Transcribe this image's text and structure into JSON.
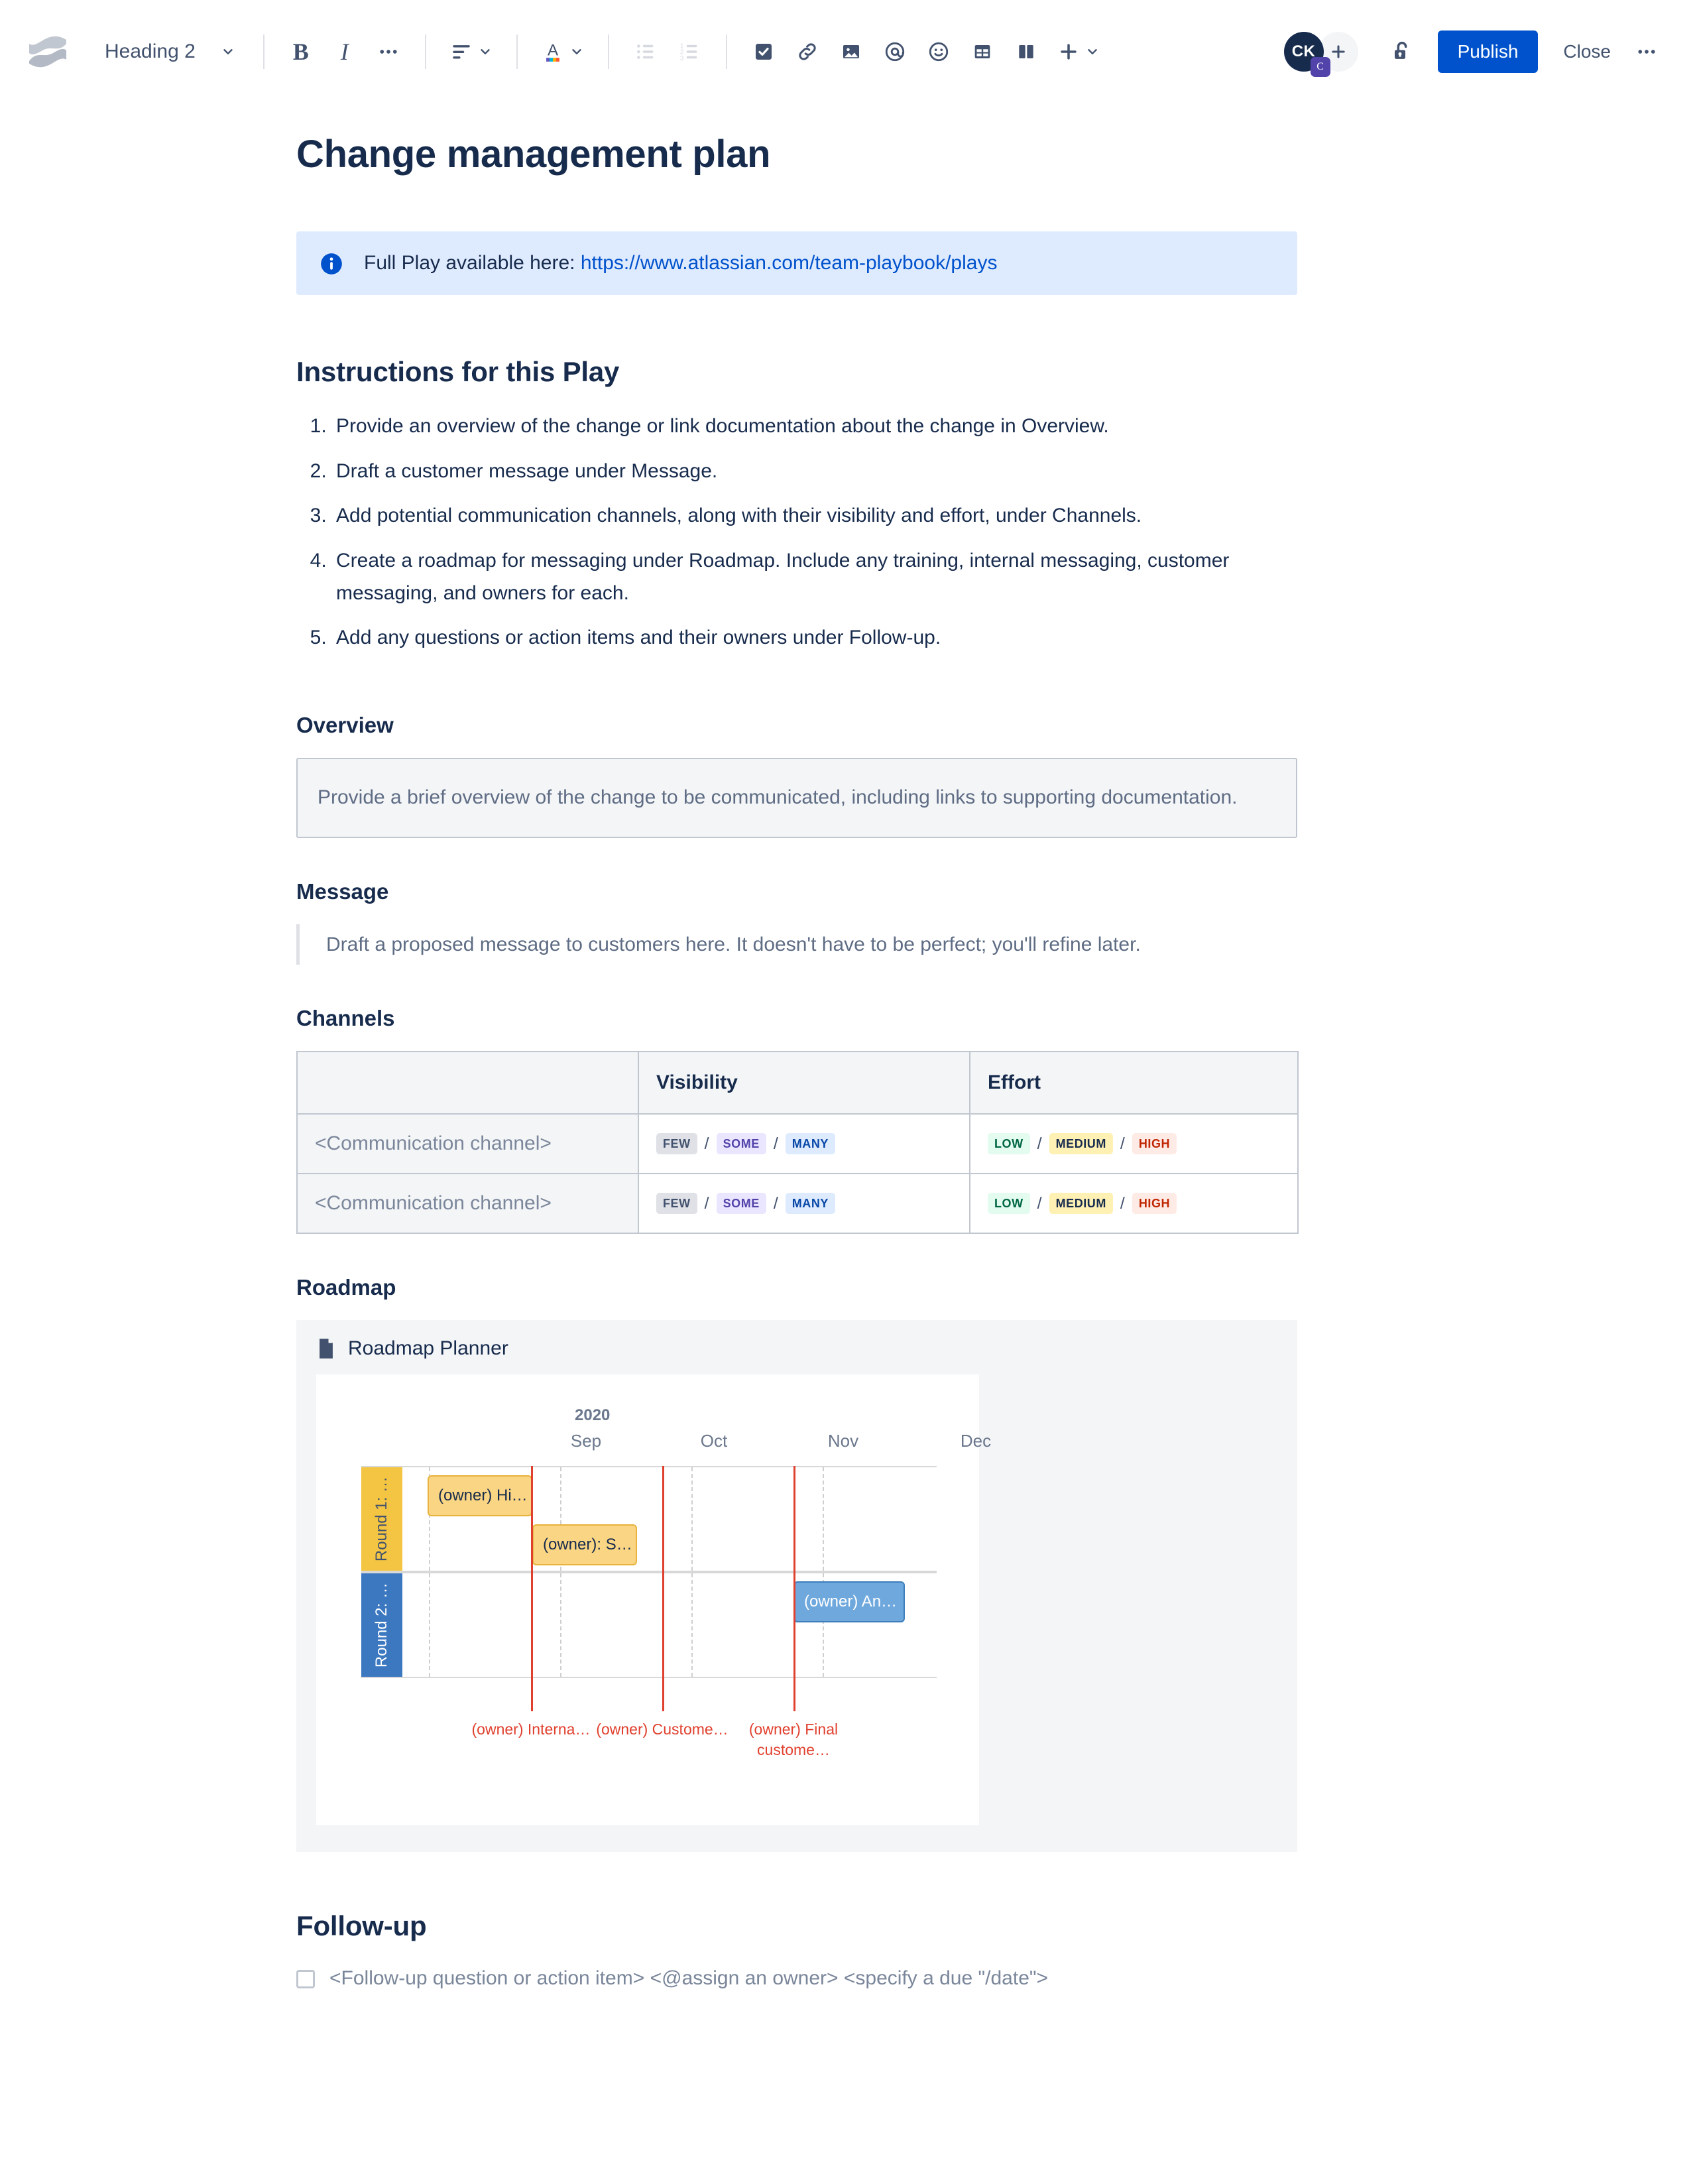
{
  "toolbar": {
    "logo_name": "confluence-logo",
    "heading_select": {
      "label": "Heading 2"
    },
    "buttons": [
      {
        "name": "bold",
        "label": "B"
      },
      {
        "name": "italic",
        "label": "I"
      },
      {
        "name": "more-formatting",
        "label": "..."
      },
      {
        "name": "text-align",
        "label": "Align"
      },
      {
        "name": "text-color",
        "label": "A"
      },
      {
        "name": "bullet-list",
        "label": "Bullet list"
      },
      {
        "name": "numbered-list",
        "label": "Numbered list"
      },
      {
        "name": "action-item",
        "label": "Action item"
      },
      {
        "name": "link",
        "label": "Link"
      },
      {
        "name": "image",
        "label": "Image"
      },
      {
        "name": "mention",
        "label": "Mention"
      },
      {
        "name": "emoji",
        "label": "Emoji"
      },
      {
        "name": "table",
        "label": "Table"
      },
      {
        "name": "layout",
        "label": "Layout"
      },
      {
        "name": "insert-more",
        "label": "Insert"
      }
    ],
    "avatar": {
      "initials": "CK",
      "badge": "C"
    },
    "add_people_label": "+",
    "publish_label": "Publish",
    "close_label": "Close",
    "more_label": "···",
    "accent_color": "#0052CC"
  },
  "document": {
    "title": "Change management plan",
    "info_panel": {
      "prefix": "Full Play available here: ",
      "link_text": "https://www.atlassian.com/team-playbook/plays"
    },
    "instructions_heading": "Instructions for this Play",
    "instructions": [
      "Provide an overview of the change or link documentation about the change in Overview.",
      "Draft a customer message under Message.",
      "Add potential communication channels, along with their visibility and effort, under Channels.",
      "Create a roadmap for messaging under Roadmap. Include any training, internal messaging, customer messaging, and owners for each.",
      "Add any questions or action items and their owners under Follow-up."
    ],
    "overview": {
      "heading": "Overview",
      "placeholder": "Provide a brief overview of the change to be communicated, including links to supporting documentation."
    },
    "message": {
      "heading": "Message",
      "placeholder": "Draft a proposed message to customers here. It doesn't have to be perfect; you'll refine later."
    },
    "channels": {
      "heading": "Channels",
      "columns": [
        "",
        "Visibility",
        "Effort"
      ],
      "rows": [
        {
          "name": "<Communication channel>",
          "visibility": [
            "FEW",
            "SOME",
            "MANY"
          ],
          "effort": [
            "LOW",
            "MEDIUM",
            "HIGH"
          ]
        },
        {
          "name": "<Communication channel>",
          "visibility": [
            "FEW",
            "SOME",
            "MANY"
          ],
          "effort": [
            "LOW",
            "MEDIUM",
            "HIGH"
          ]
        }
      ],
      "separator": "/",
      "lozenge_colors": {
        "FEW": {
          "bg": "#DFE1E6",
          "fg": "#42526E"
        },
        "SOME": {
          "bg": "#EAE6FF",
          "fg": "#5243AA"
        },
        "MANY": {
          "bg": "#DEEBFF",
          "fg": "#0747A6"
        },
        "LOW": {
          "bg": "#E3FCEF",
          "fg": "#006644"
        },
        "MEDIUM": {
          "bg": "#FFF0B3",
          "fg": "#172B4D"
        },
        "HIGH": {
          "bg": "#FFEBE6",
          "fg": "#BF2600"
        }
      }
    },
    "roadmap": {
      "heading": "Roadmap",
      "macro_title": "Roadmap Planner",
      "macro_icon": "page-icon"
    },
    "followup": {
      "heading": "Follow-up",
      "item": "<Follow-up question or action item> <@assign an owner> <specify a due \"/date\">",
      "checked": false
    }
  },
  "chart_data": {
    "type": "timeline",
    "title": "Roadmap Planner",
    "year": "2020",
    "categories": [
      "Sep",
      "Oct",
      "Nov",
      "Dec"
    ],
    "lanes": [
      {
        "label": "Round 1: …",
        "color": "#F4C542",
        "text_color": "#172B4D"
      },
      {
        "label": "Round 2: …",
        "color": "#3C78C0",
        "text_color": "#FFFFFF"
      }
    ],
    "bars": [
      {
        "lane": 0,
        "label": "(owner) Hi…",
        "start_month": "Sep",
        "start": 0.07,
        "end": 0.26,
        "color": "#FAD583",
        "border": "#E8B33E",
        "row": 0
      },
      {
        "lane": 0,
        "label": "(owner): S…",
        "start_month": "Oct",
        "start": 0.28,
        "end": 0.5,
        "color": "#FAD583",
        "border": "#E8B33E",
        "row": 1
      },
      {
        "lane": 1,
        "label": "(owner) An…",
        "start_month": "Dec",
        "start": 0.53,
        "end": 0.77,
        "color": "#6FA8DC",
        "border": "#3D7EBB",
        "row": 0
      }
    ],
    "markers": [
      {
        "label": "(owner) Interna…",
        "position": 0.26,
        "color": "#E0402E"
      },
      {
        "label": "(owner) Custome…",
        "position": 0.5,
        "color": "#E0402E"
      },
      {
        "label": "(owner) Final custome…",
        "position": 0.72,
        "color": "#E0402E"
      }
    ],
    "grid": true,
    "legend": "none"
  }
}
